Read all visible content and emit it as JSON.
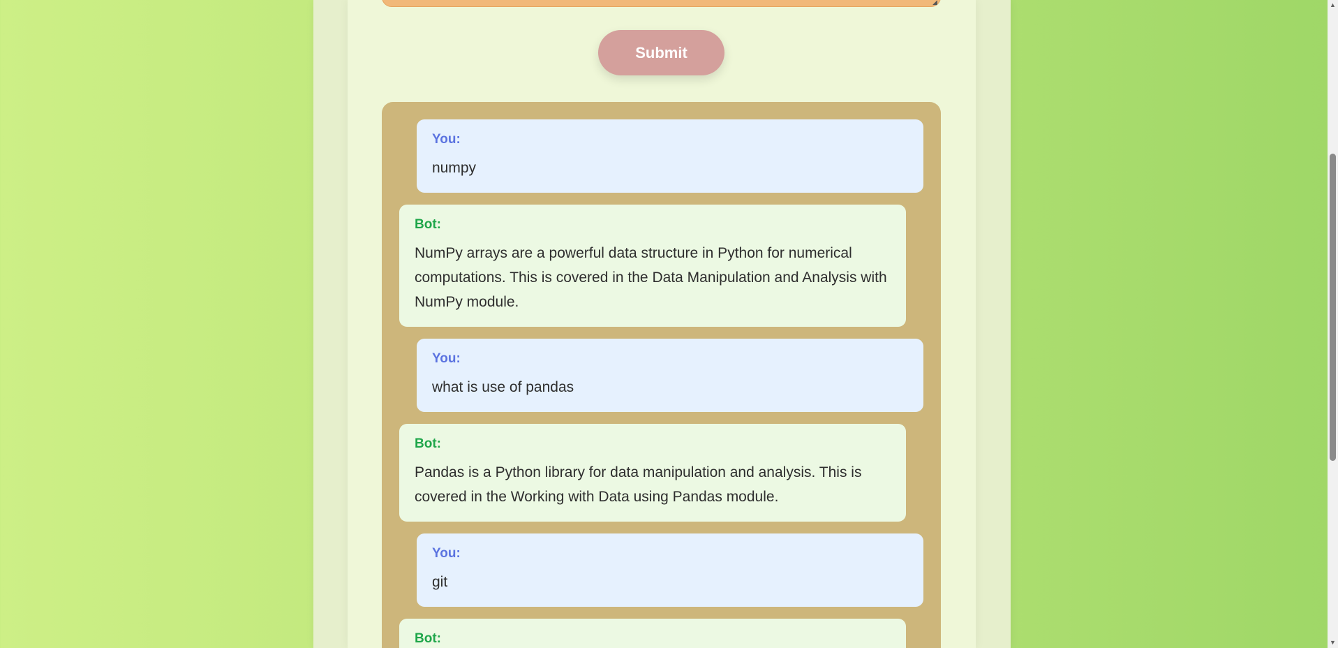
{
  "form": {
    "submit_label": "Submit"
  },
  "chat": {
    "messages": [
      {
        "role": "user",
        "speaker": "You:",
        "text": "numpy"
      },
      {
        "role": "bot",
        "speaker": "Bot:",
        "text": "NumPy arrays are a powerful data structure in Python for numerical computations. This is covered in the Data Manipulation and Analysis with NumPy module."
      },
      {
        "role": "user",
        "speaker": "You:",
        "text": "what is use of pandas"
      },
      {
        "role": "bot",
        "speaker": "Bot:",
        "text": "Pandas is a Python library for data manipulation and analysis. This is covered in the Working with Data using Pandas module."
      },
      {
        "role": "user",
        "speaker": "You:",
        "text": "git"
      },
      {
        "role": "bot",
        "speaker": "Bot:",
        "text": ""
      }
    ]
  },
  "scrollbar": {
    "up_icon": "triangle-up-icon",
    "down_icon": "triangle-down-icon"
  },
  "colors": {
    "background_start": "#cdef86",
    "background_end": "#9fd767",
    "panel": "#eff7d8",
    "textarea": "#f1b879",
    "submit_button": "#d4a09c",
    "chat_box": "#cdb67b",
    "user_bubble": "#e6f1fe",
    "bot_bubble": "#ecf9e3",
    "user_label": "#5b73e0",
    "bot_label": "#1fa64a"
  }
}
